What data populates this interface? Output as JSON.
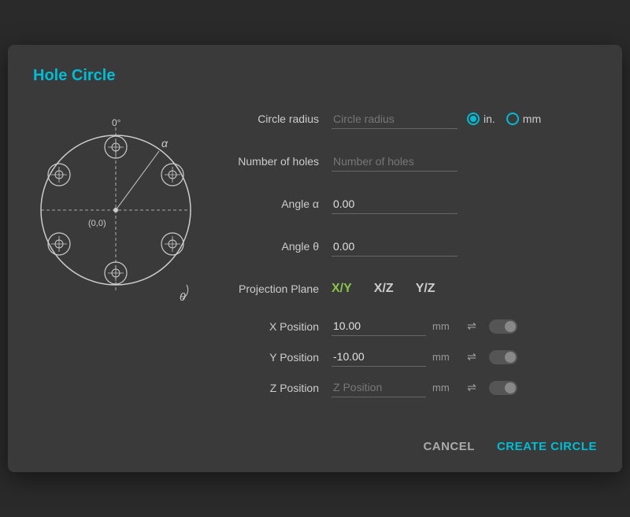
{
  "dialog": {
    "title": "Hole Circle"
  },
  "form": {
    "circle_radius_label": "Circle radius",
    "circle_radius_placeholder": "Circle radius",
    "circle_radius_value": "",
    "unit_in_label": "in.",
    "unit_mm_label": "mm",
    "unit_in_selected": true,
    "unit_mm_selected": false,
    "num_holes_label": "Number of holes",
    "num_holes_placeholder": "Number of holes",
    "num_holes_value": "",
    "angle_a_label": "Angle α",
    "angle_a_value": "0.00",
    "angle_theta_label": "Angle θ",
    "angle_theta_value": "0.00",
    "projection_label": "Projection Plane",
    "proj_xy": "X/Y",
    "proj_xz": "X/Z",
    "proj_yz": "Y/Z",
    "proj_active": "X/Y",
    "x_pos_label": "X Position",
    "x_pos_value": "10.00",
    "y_pos_label": "Y Position",
    "y_pos_value": "-10.00",
    "z_pos_label": "Z Position",
    "z_pos_placeholder": "Z Position",
    "z_pos_value": "",
    "pos_unit": "mm"
  },
  "footer": {
    "cancel_label": "CANCEL",
    "create_label": "CREATE CIRCLE"
  },
  "icons": {
    "transfer": "⇌"
  }
}
